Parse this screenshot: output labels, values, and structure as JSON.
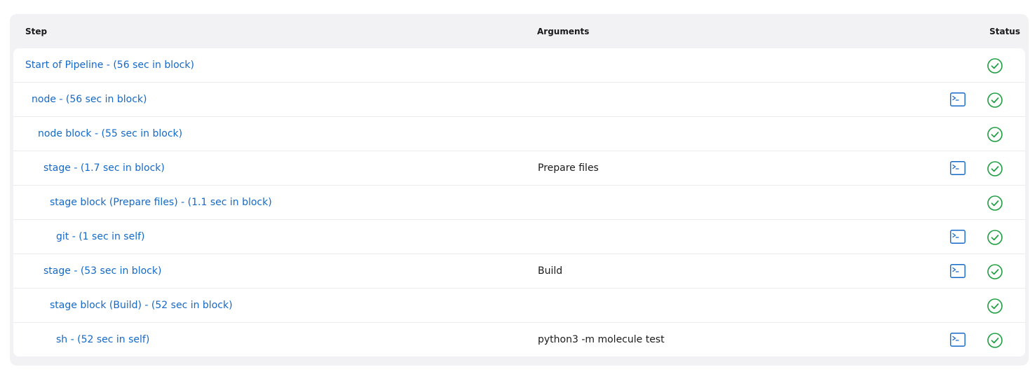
{
  "table": {
    "headers": {
      "step": "Step",
      "arguments": "Arguments",
      "status": "Status"
    },
    "rows": [
      {
        "step": "Start of Pipeline - (56 sec in block)",
        "arguments": "",
        "has_console": false,
        "status": "success"
      },
      {
        "step": "node - (56 sec in block)",
        "arguments": "",
        "has_console": true,
        "status": "success"
      },
      {
        "step": "node block - (55 sec in block)",
        "arguments": "",
        "has_console": false,
        "status": "success"
      },
      {
        "step": "stage - (1.7 sec in block)",
        "arguments": "Prepare files",
        "has_console": true,
        "status": "success"
      },
      {
        "step": "stage block (Prepare files) - (1.1 sec in block)",
        "arguments": "",
        "has_console": false,
        "status": "success"
      },
      {
        "step": "git - (1 sec in self)",
        "arguments": "",
        "has_console": true,
        "status": "success"
      },
      {
        "step": "stage - (53 sec in block)",
        "arguments": "Build",
        "has_console": true,
        "status": "success"
      },
      {
        "step": "stage block (Build) - (52 sec in block)",
        "arguments": "",
        "has_console": false,
        "status": "success"
      },
      {
        "step": "sh - (52 sec in self)",
        "arguments": "python3 -m molecule test",
        "has_console": true,
        "status": "success"
      }
    ]
  },
  "colors": {
    "link": "#1469c8",
    "success": "#1e9e40",
    "console": "#1469c8"
  },
  "icons": {
    "console": "terminal-icon",
    "status": "check-circle-icon"
  }
}
